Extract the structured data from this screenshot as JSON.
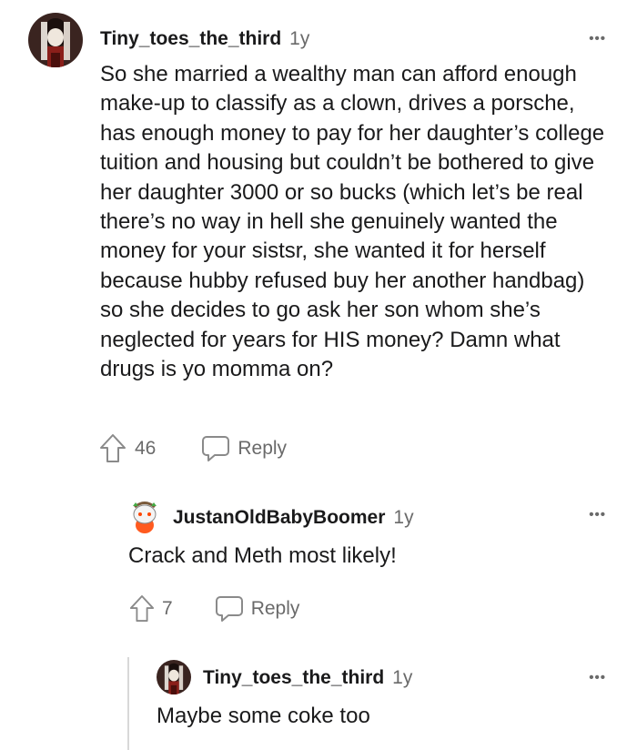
{
  "comments": [
    {
      "username": "Tiny_toes_the_third",
      "age": "1y",
      "text": "So she married a wealthy man can afford enough make-up to classify as a clown, drives a porsche, has enough money to pay for her daughter’s college tuition and housing but couldn’t be bothered to give her daughter 3000 or so bucks (which let’s be real there’s no way in hell she genuinely wanted the money for your sistsr, she wanted it for herself because hubby refused buy her another handbag) so she decides to go ask her son whom she’s neglected for years for HIS money? Damn what drugs is yo momma on?",
      "upvotes": "46",
      "reply_label": "Reply",
      "more": "•••"
    },
    {
      "username": "JustanOldBabyBoomer",
      "age": "1y",
      "text": "Crack and Meth most likely!",
      "upvotes": "7",
      "reply_label": "Reply",
      "more": "•••"
    },
    {
      "username": "Tiny_toes_the_third",
      "age": "1y",
      "text": "Maybe some coke too",
      "more": "•••"
    }
  ],
  "icons": {
    "upvote": "upvote-arrow-icon",
    "reply": "speech-bubble-icon",
    "more": "more-options-icon"
  },
  "colors": {
    "text": "#1a1a1b",
    "muted": "#6a6a6a",
    "thread_line": "#d8d8d8"
  }
}
